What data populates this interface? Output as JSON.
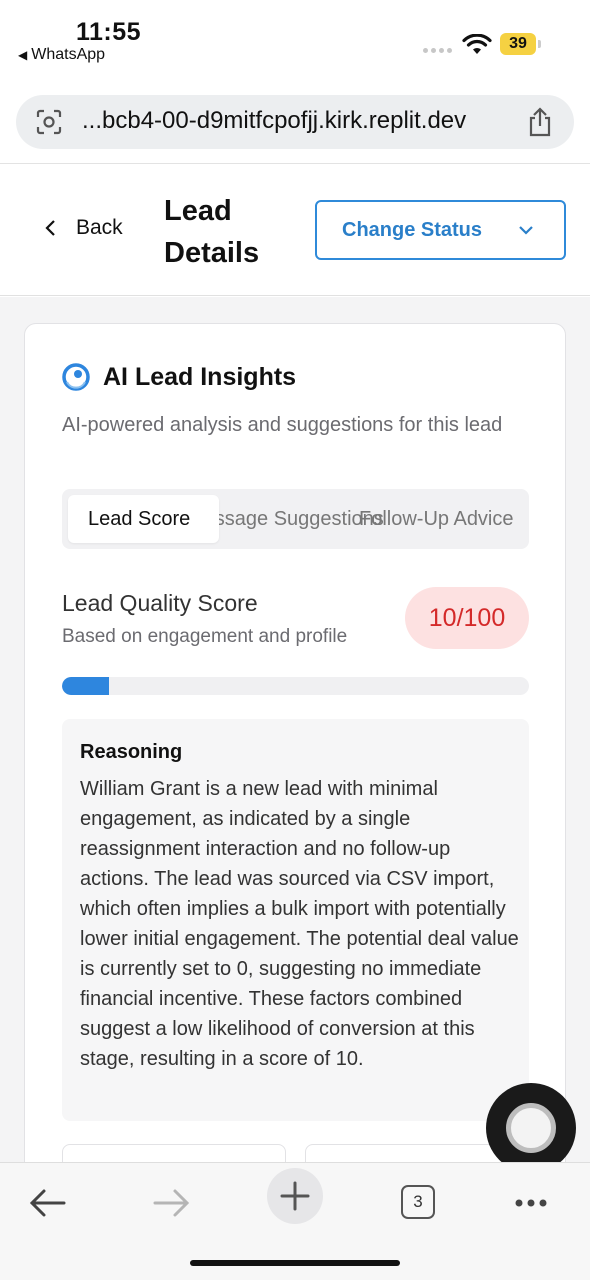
{
  "status_bar": {
    "time": "11:55",
    "back_app": "WhatsApp",
    "battery": "39"
  },
  "browser": {
    "url": "...bcb4-00-d9mitfcpofjj.kirk.replit.dev",
    "tab_count": "3"
  },
  "header": {
    "back_label": "Back",
    "title": "Lead Details",
    "change_status_label": "Change Status"
  },
  "insights": {
    "title": "AI Lead Insights",
    "description": "AI-powered analysis and suggestions for this lead",
    "tabs": [
      {
        "label": "Lead Score"
      },
      {
        "label": "Message Suggestions"
      },
      {
        "label": "Follow-Up Advice"
      }
    ],
    "active_tab": 0,
    "score": {
      "title": "Lead Quality Score",
      "subtitle": "Based on engagement and profile",
      "value_label": "10/100",
      "value": 10,
      "max": 100
    },
    "reasoning": {
      "title": "Reasoning",
      "text": "William Grant is a new lead with minimal engagement, as indicated by a single reassignment interaction and no follow-up actions. The lead was sourced via CSV import, which often implies a bulk import with potentially lower initial engagement. The potential deal value is currently set to 0, suggesting no immediate financial incentive. These factors combined suggest a low likelihood of conversion at this stage, resulting in a score of 10."
    }
  },
  "colors": {
    "accent": "#2e86de",
    "badge_bg": "#fde1e1",
    "badge_text": "#d42a2a"
  },
  "icons": {
    "insights": "ai-brain-icon",
    "back": "chevron-left-icon",
    "dropdown": "chevron-down-icon",
    "toolbar": [
      "arrow-left-icon",
      "arrow-right-icon",
      "plus-icon",
      "tabs-icon",
      "more-icon"
    ]
  }
}
